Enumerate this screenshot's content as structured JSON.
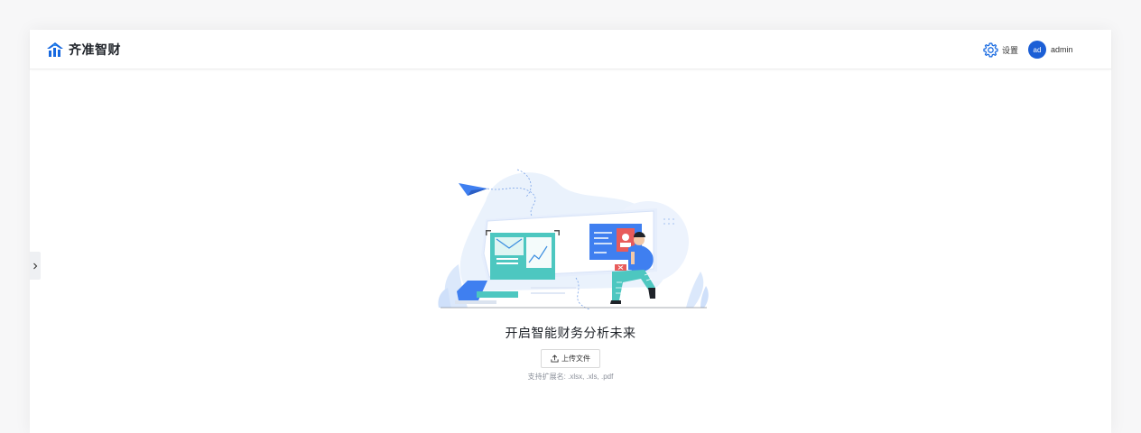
{
  "header": {
    "brand_name": "齐准智财",
    "brand_logo_icon": "bar-chart-house-logo",
    "settings_icon": "gear-icon",
    "settings_label": "设置",
    "user": {
      "avatar_initials": "ad",
      "name": "admin"
    }
  },
  "sidebar": {
    "toggle_icon": "chevron-right-icon"
  },
  "main": {
    "illustration": "person-with-dashboard-illustration",
    "title": "开启智能财务分析未来",
    "upload_button_label": "上传文件",
    "upload_icon": "upload-icon",
    "hint": "支持扩展名: .xlsx, .xls, .pdf"
  },
  "colors": {
    "accent": "#1c5fd6",
    "brand_blue": "#1769e0",
    "page_bg": "#f7f7f8",
    "illustration_teal": "#4dc7c0",
    "illustration_blue": "#3f7ff0"
  }
}
